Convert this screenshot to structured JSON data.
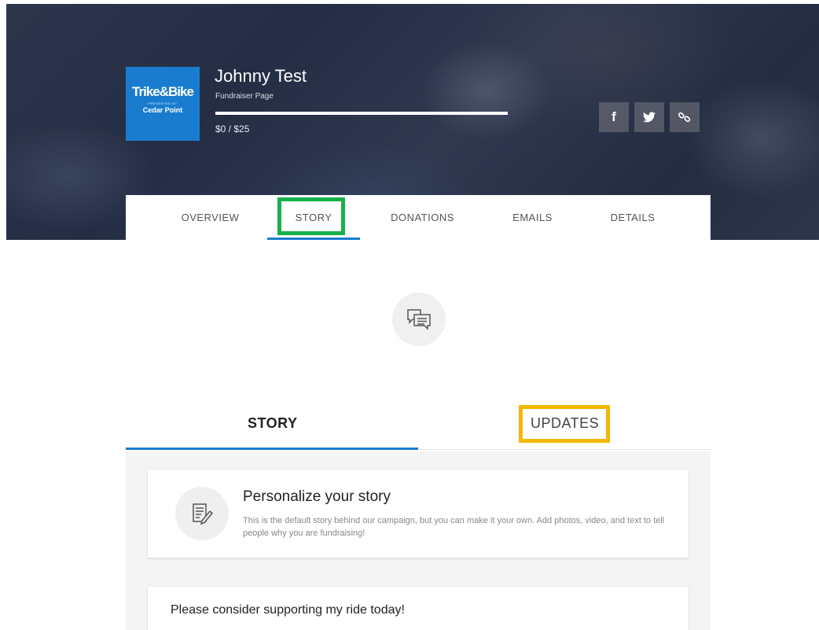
{
  "header": {
    "logo": {
      "line1": "Trike&Bike",
      "line2": "PRESENTED BY",
      "line3": "Cedar Point"
    },
    "name": "Johnny Test",
    "subtitle": "Fundraiser Page",
    "progress_fraction": 0,
    "amount": "$0 / $25",
    "share": {
      "facebook_icon": "facebook-icon",
      "twitter_icon": "twitter-icon",
      "link_icon": "link-icon"
    }
  },
  "nav": {
    "tabs": [
      "OVERVIEW",
      "STORY",
      "DONATIONS",
      "EMAILS",
      "DETAILS"
    ],
    "active": "STORY"
  },
  "story_icon": "chat-bubbles-icon",
  "subtabs": {
    "story": "STORY",
    "updates": "UPDATES",
    "active": "STORY"
  },
  "personalize": {
    "icon": "edit-document-icon",
    "title": "Personalize your story",
    "description": "This is the default story behind our campaign, but you can make it your own. Add photos, video, and text to tell people why you are fundraising!"
  },
  "story_text": "Please consider supporting my ride today!",
  "colors": {
    "accent": "#1a7ccf",
    "highlight_green": "#17b14b",
    "highlight_yellow": "#f4b700"
  }
}
